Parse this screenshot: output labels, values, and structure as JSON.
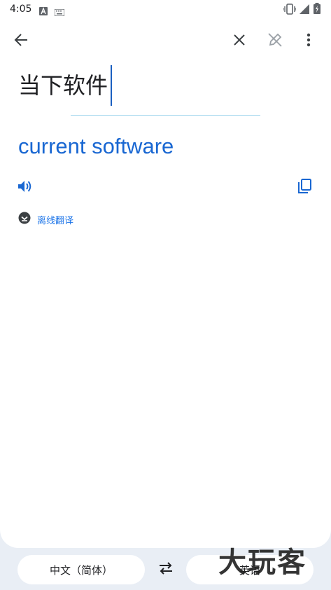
{
  "status_bar": {
    "time": "4:05",
    "icons": [
      "a-notification-icon",
      "keyboard-icon",
      "vibrate-icon",
      "signal-icon",
      "battery-icon"
    ]
  },
  "toolbar": {
    "back_icon": "arrow-back-icon",
    "clear_icon": "close-icon",
    "handwrite_icon": "pen-off-icon",
    "menu_icon": "more-vert-icon"
  },
  "input": {
    "source_text": "当下软件"
  },
  "result": {
    "translation": "current software",
    "speak_icon": "volume-icon",
    "copy_icon": "copy-icon",
    "offline_label": "离线翻译"
  },
  "language_bar": {
    "source_language": "中文（简体）",
    "target_language": "英语",
    "swap_icon": "swap-arrows-icon"
  },
  "watermark": {
    "text": "大玩客"
  },
  "colors": {
    "accent": "#1967d2",
    "background": "#e9eef5",
    "card": "#ffffff",
    "divider": "#a8d8ee"
  }
}
